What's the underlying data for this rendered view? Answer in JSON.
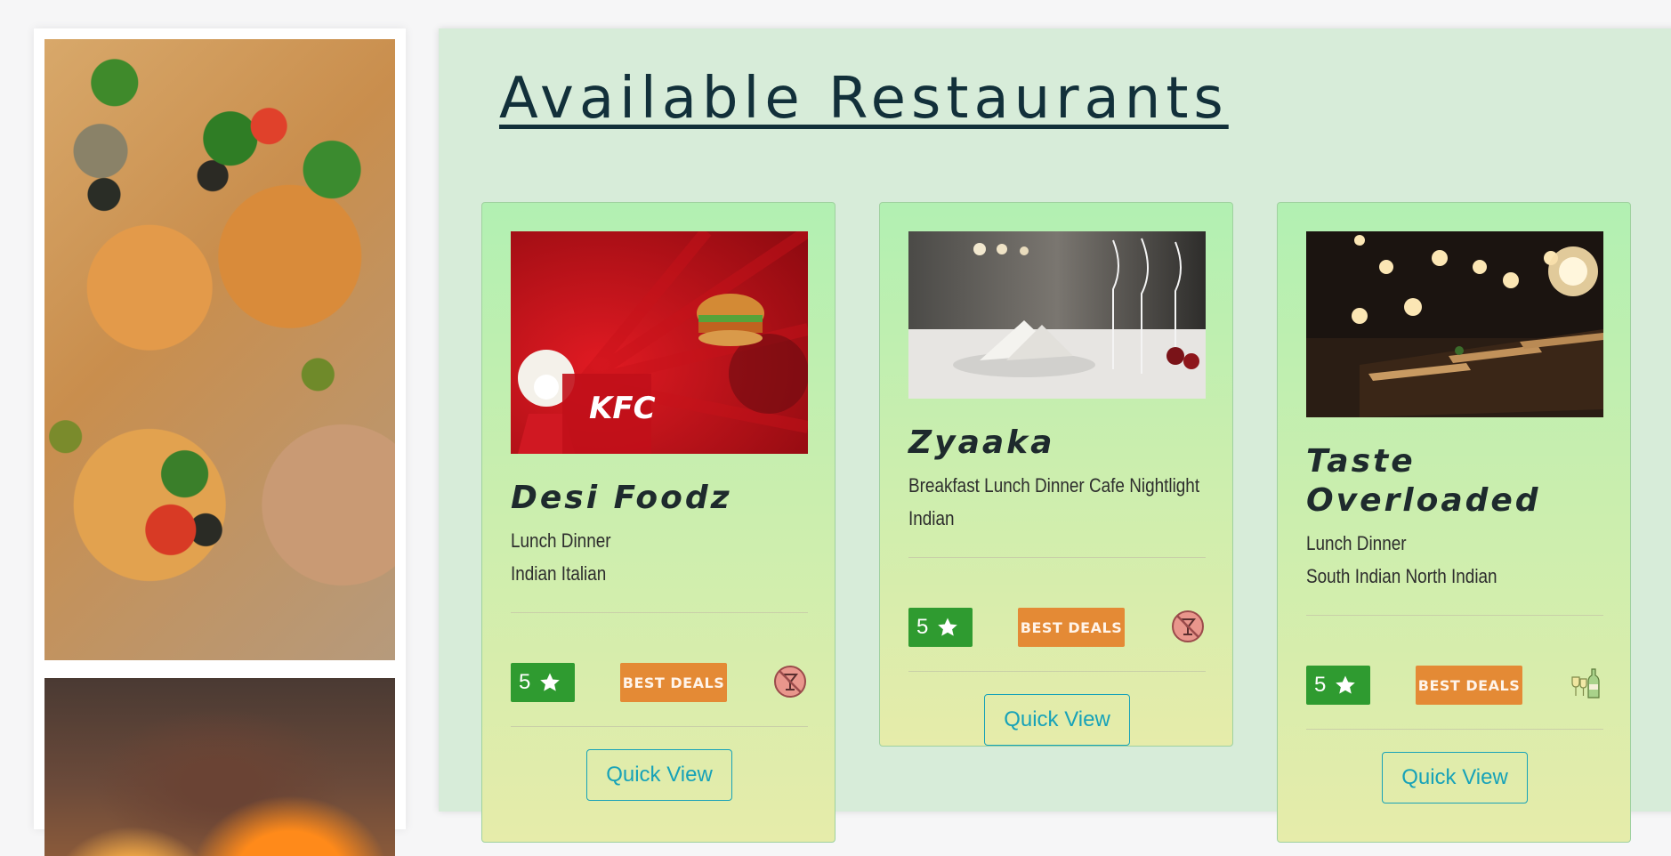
{
  "page": {
    "title": "Available Restaurants"
  },
  "colors": {
    "rating_bg": "#2f9b30",
    "deals_bg": "#e48a35",
    "quick_view": "#17a2b8",
    "panel_bg": "#d7ecd9"
  },
  "cards": [
    {
      "name": "Desi Foodz",
      "meals": "Lunch Dinner",
      "cuisines": "Indian Italian",
      "rating": "5",
      "deals_label": "BEST DEALS",
      "drinks_icon": "no-alcohol-icon",
      "button": "Quick View",
      "image_brand": "KFC"
    },
    {
      "name": "Zyaaka",
      "meals": "Breakfast Lunch Dinner Cafe Nightlight",
      "cuisines": "Indian",
      "rating": "5",
      "deals_label": "BEST DEALS",
      "drinks_icon": "no-alcohol-icon",
      "button": "Quick View"
    },
    {
      "name_line1": "Taste",
      "name_line2": "Overloaded",
      "meals": "Lunch Dinner",
      "cuisines": "South Indian North Indian",
      "rating": "5",
      "deals_label": "BEST DEALS",
      "drinks_icon": "wine-bottle-icon",
      "button": "Quick View"
    }
  ]
}
